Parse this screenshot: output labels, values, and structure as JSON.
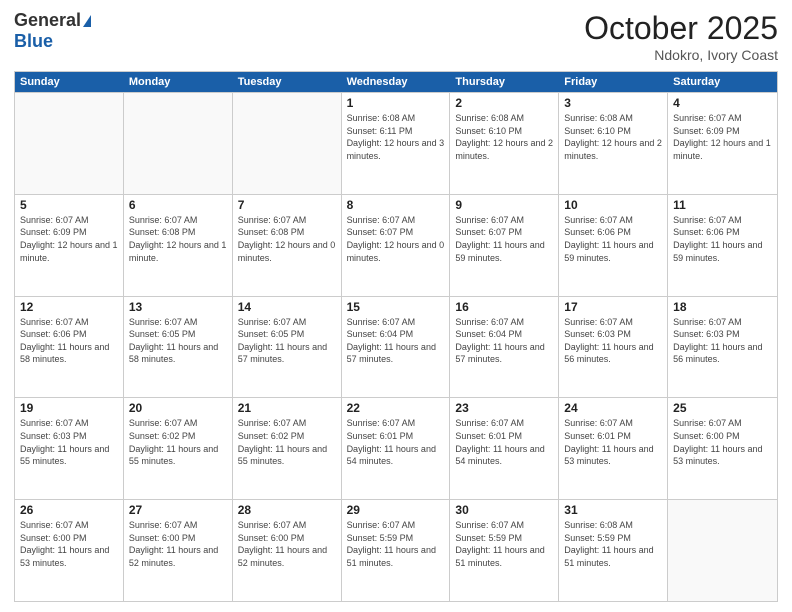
{
  "logo": {
    "general": "General",
    "blue": "Blue"
  },
  "header": {
    "month": "October 2025",
    "location": "Ndokro, Ivory Coast"
  },
  "days_of_week": [
    "Sunday",
    "Monday",
    "Tuesday",
    "Wednesday",
    "Thursday",
    "Friday",
    "Saturday"
  ],
  "weeks": [
    [
      {
        "day": "",
        "info": ""
      },
      {
        "day": "",
        "info": ""
      },
      {
        "day": "",
        "info": ""
      },
      {
        "day": "1",
        "info": "Sunrise: 6:08 AM\nSunset: 6:11 PM\nDaylight: 12 hours and 3 minutes."
      },
      {
        "day": "2",
        "info": "Sunrise: 6:08 AM\nSunset: 6:10 PM\nDaylight: 12 hours and 2 minutes."
      },
      {
        "day": "3",
        "info": "Sunrise: 6:08 AM\nSunset: 6:10 PM\nDaylight: 12 hours and 2 minutes."
      },
      {
        "day": "4",
        "info": "Sunrise: 6:07 AM\nSunset: 6:09 PM\nDaylight: 12 hours and 1 minute."
      }
    ],
    [
      {
        "day": "5",
        "info": "Sunrise: 6:07 AM\nSunset: 6:09 PM\nDaylight: 12 hours and 1 minute."
      },
      {
        "day": "6",
        "info": "Sunrise: 6:07 AM\nSunset: 6:08 PM\nDaylight: 12 hours and 1 minute."
      },
      {
        "day": "7",
        "info": "Sunrise: 6:07 AM\nSunset: 6:08 PM\nDaylight: 12 hours and 0 minutes."
      },
      {
        "day": "8",
        "info": "Sunrise: 6:07 AM\nSunset: 6:07 PM\nDaylight: 12 hours and 0 minutes."
      },
      {
        "day": "9",
        "info": "Sunrise: 6:07 AM\nSunset: 6:07 PM\nDaylight: 11 hours and 59 minutes."
      },
      {
        "day": "10",
        "info": "Sunrise: 6:07 AM\nSunset: 6:06 PM\nDaylight: 11 hours and 59 minutes."
      },
      {
        "day": "11",
        "info": "Sunrise: 6:07 AM\nSunset: 6:06 PM\nDaylight: 11 hours and 59 minutes."
      }
    ],
    [
      {
        "day": "12",
        "info": "Sunrise: 6:07 AM\nSunset: 6:06 PM\nDaylight: 11 hours and 58 minutes."
      },
      {
        "day": "13",
        "info": "Sunrise: 6:07 AM\nSunset: 6:05 PM\nDaylight: 11 hours and 58 minutes."
      },
      {
        "day": "14",
        "info": "Sunrise: 6:07 AM\nSunset: 6:05 PM\nDaylight: 11 hours and 57 minutes."
      },
      {
        "day": "15",
        "info": "Sunrise: 6:07 AM\nSunset: 6:04 PM\nDaylight: 11 hours and 57 minutes."
      },
      {
        "day": "16",
        "info": "Sunrise: 6:07 AM\nSunset: 6:04 PM\nDaylight: 11 hours and 57 minutes."
      },
      {
        "day": "17",
        "info": "Sunrise: 6:07 AM\nSunset: 6:03 PM\nDaylight: 11 hours and 56 minutes."
      },
      {
        "day": "18",
        "info": "Sunrise: 6:07 AM\nSunset: 6:03 PM\nDaylight: 11 hours and 56 minutes."
      }
    ],
    [
      {
        "day": "19",
        "info": "Sunrise: 6:07 AM\nSunset: 6:03 PM\nDaylight: 11 hours and 55 minutes."
      },
      {
        "day": "20",
        "info": "Sunrise: 6:07 AM\nSunset: 6:02 PM\nDaylight: 11 hours and 55 minutes."
      },
      {
        "day": "21",
        "info": "Sunrise: 6:07 AM\nSunset: 6:02 PM\nDaylight: 11 hours and 55 minutes."
      },
      {
        "day": "22",
        "info": "Sunrise: 6:07 AM\nSunset: 6:01 PM\nDaylight: 11 hours and 54 minutes."
      },
      {
        "day": "23",
        "info": "Sunrise: 6:07 AM\nSunset: 6:01 PM\nDaylight: 11 hours and 54 minutes."
      },
      {
        "day": "24",
        "info": "Sunrise: 6:07 AM\nSunset: 6:01 PM\nDaylight: 11 hours and 53 minutes."
      },
      {
        "day": "25",
        "info": "Sunrise: 6:07 AM\nSunset: 6:00 PM\nDaylight: 11 hours and 53 minutes."
      }
    ],
    [
      {
        "day": "26",
        "info": "Sunrise: 6:07 AM\nSunset: 6:00 PM\nDaylight: 11 hours and 53 minutes."
      },
      {
        "day": "27",
        "info": "Sunrise: 6:07 AM\nSunset: 6:00 PM\nDaylight: 11 hours and 52 minutes."
      },
      {
        "day": "28",
        "info": "Sunrise: 6:07 AM\nSunset: 6:00 PM\nDaylight: 11 hours and 52 minutes."
      },
      {
        "day": "29",
        "info": "Sunrise: 6:07 AM\nSunset: 5:59 PM\nDaylight: 11 hours and 51 minutes."
      },
      {
        "day": "30",
        "info": "Sunrise: 6:07 AM\nSunset: 5:59 PM\nDaylight: 11 hours and 51 minutes."
      },
      {
        "day": "31",
        "info": "Sunrise: 6:08 AM\nSunset: 5:59 PM\nDaylight: 11 hours and 51 minutes."
      },
      {
        "day": "",
        "info": ""
      }
    ]
  ]
}
